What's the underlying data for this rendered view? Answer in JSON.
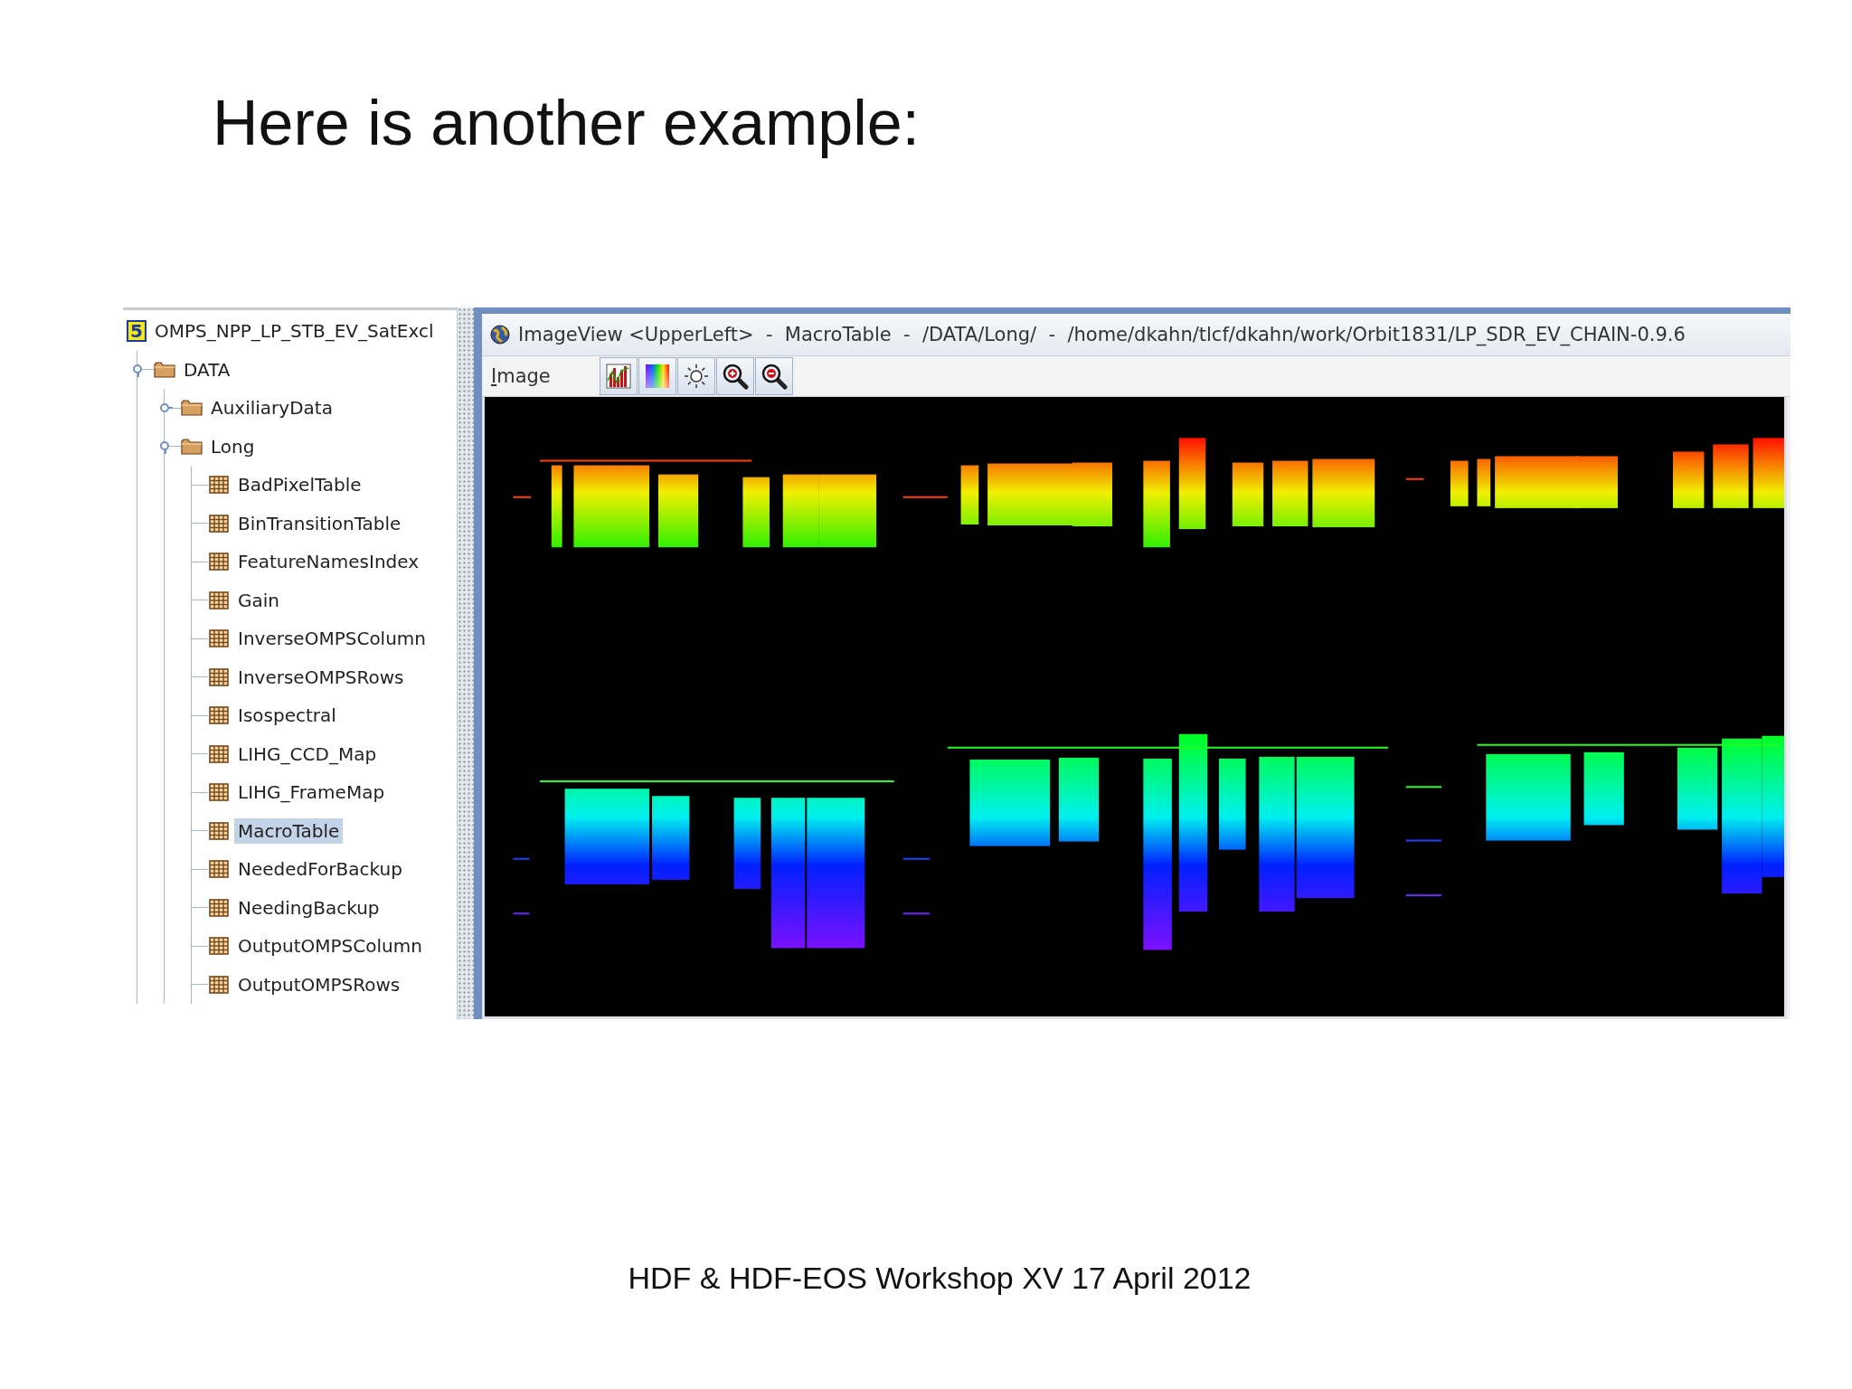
{
  "slide_title": "Here is another example:",
  "tree": {
    "label": "OMPS_NPP_LP_STB_EV_SatExcl",
    "kind": "file",
    "badge": "5",
    "selected": false,
    "children": [
      {
        "label": "DATA",
        "kind": "group",
        "expanded": true,
        "selected": false,
        "children": [
          {
            "label": "AuxiliaryData",
            "kind": "group",
            "expanded": false,
            "selected": false
          },
          {
            "label": "Long",
            "kind": "group",
            "expanded": true,
            "selected": false,
            "children": [
              {
                "label": "BadPixelTable",
                "kind": "dataset",
                "selected": false
              },
              {
                "label": "BinTransitionTable",
                "kind": "dataset",
                "selected": false
              },
              {
                "label": "FeatureNamesIndex",
                "kind": "dataset",
                "selected": false
              },
              {
                "label": "Gain",
                "kind": "dataset",
                "selected": false
              },
              {
                "label": "InverseOMPSColumn",
                "kind": "dataset",
                "selected": false
              },
              {
                "label": "InverseOMPSRows",
                "kind": "dataset",
                "selected": false
              },
              {
                "label": "Isospectral",
                "kind": "dataset",
                "selected": false
              },
              {
                "label": "LIHG_CCD_Map",
                "kind": "dataset",
                "selected": false
              },
              {
                "label": "LIHG_FrameMap",
                "kind": "dataset",
                "selected": false
              },
              {
                "label": "MacroTable",
                "kind": "dataset",
                "selected": true
              },
              {
                "label": "NeededForBackup",
                "kind": "dataset",
                "selected": false
              },
              {
                "label": "NeedingBackup",
                "kind": "dataset",
                "selected": false
              },
              {
                "label": "OutputOMPSColumn",
                "kind": "dataset",
                "selected": false
              },
              {
                "label": "OutputOMPSRows",
                "kind": "dataset",
                "selected": false
              }
            ]
          }
        ]
      }
    ]
  },
  "image_window": {
    "title": "ImageView <UpperLeft>  -  MacroTable  -  /DATA/Long/  -  /home/dkahn/tlcf/dkahn/work/Orbit1831/LP_SDR_EV_CHAIN-0.9.6",
    "menu": [
      "Image"
    ],
    "toolbar": [
      {
        "kind": "histogram"
      },
      {
        "kind": "palette"
      },
      {
        "kind": "brightness"
      },
      {
        "kind": "zoom-in"
      },
      {
        "kind": "zoom-out"
      }
    ]
  },
  "footer": "HDF & HDF-EOS Workshop XV 17 April 2012"
}
